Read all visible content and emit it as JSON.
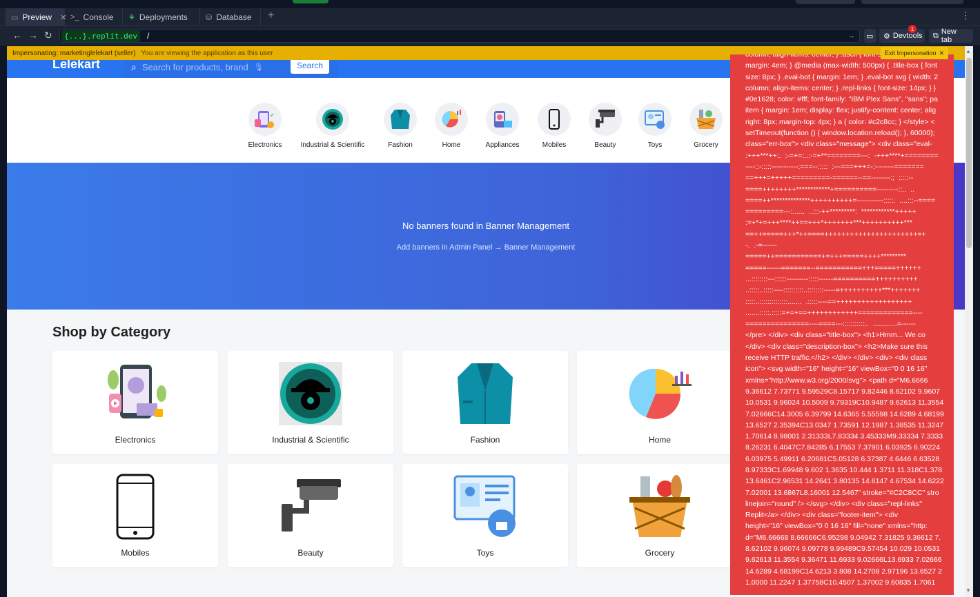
{
  "tabs": [
    {
      "label": "Preview",
      "icon": "monitor-icon",
      "active": true
    },
    {
      "label": "Console",
      "icon": "terminal-icon"
    },
    {
      "label": "Deployments",
      "icon": "deploy-icon"
    },
    {
      "label": "Database",
      "icon": "database-icon"
    }
  ],
  "address": {
    "domain": "{...}.replit.dev",
    "path": "/",
    "devtools_label": "Devtools",
    "devtools_badge": "1",
    "newtab_label": "New tab"
  },
  "impersonation": {
    "user": "Impersonating: marketinglelekart (seller)",
    "message": "You are viewing the application as this user",
    "exit_label": "Exit Impersonation"
  },
  "site": {
    "logo": "Lelekart",
    "search_placeholder": "Search for products, brand",
    "search_button": "Search"
  },
  "category_strip": [
    "Electronics",
    "Industrial & Scientific",
    "Fashion",
    "Home",
    "Appliances",
    "Mobiles",
    "Beauty",
    "Toys",
    "Grocery"
  ],
  "banner": {
    "title": "No banners found in Banner Management",
    "subtitle": "Add banners in Admin Panel → Banner Management"
  },
  "shop_by_category": {
    "title": "Shop by Category",
    "cards": [
      "Electronics",
      "Industrial & Scientific",
      "Fashion",
      "Home",
      "Mobiles",
      "Beauty",
      "Toys",
      "Grocery"
    ]
  },
  "error_overlay_text": "column; align-items: center; } .ascii { font-size: 6px; text-align\nmargin: 4em; } @media (max-width: 500px) { .title-box { font\nsize: 8px; } .eval-bot { margin: 1em; } .eval-bot svg { width: 2\ncolumn; align-items: center; } .repl-links { font-size: 14px; } }\n#0e1628; color: #fff; font-family: \"IBM Plex Sans\", \"sans\"; pa\nitem { margin: 1em; display: flex; justify-content: center; alig\nright: 8px; margin-top: 4px; } a { color: #c2c8cc; } </style> <\nsetTimeout(function () { window.location.reload(); }, 60000);\nclass=\"err-box\"> <div class=\"message\"> <div class=\"eval-\n:+++***++:.  :-=+=:..:-=+**========---:  -+++****+========\n----::-:::::-----------:===--:::::  :---===+++=-:--------=======\n==+++=+++++=========-======--==--------:;  :::::--\n====++++++++************+==========---------::..  ..\n====++**************++++++++++=-----------:::::.  ....:::--====\n=========---:......  ..:::-++*********:  ************+++++\n:=+*+=+++****++==+++*+++++++***++++++++++***\n==++=====+++*++====++++++++++++++++++++++=+\n-.  .-=------\n=====++===========+=+++=====++++*********\n=====------=======--===========+++=====++++++\n...::::::::---::::::---------:::::------==========++++++++++\n..:::::..:::::----::::::::::..::::::::-----=++++++++++***+++++++\n:::::..::::::::::::::.......  .:::::----==++++++++++++++++++\n.......:::::.:::::=+=+==++++++++++++=============----\n===============----====---:::::::::::..  ............=------\n</pre> </div> <div class=\"title-box\"> <h1>Hmm... We co\n</div> <div class=\"description-box\"> <h2>Make sure this\nreceive HTTP traffic.</h2> </div> </div> <div> <div class\nicon\"> <svg width=\"16\" height=\"16\" viewBox=\"0 0 16 16\"\nxmlns=\"http://www.w3.org/2000/svg\"> <path d=\"M6.6666\n9.36612 7.73771 9.59529C8.15717 9.82446 8.62102 9.9607\n10.0531 9.96024 10.5009 9.79319C10.9487 9.62613 11.3554\n7.02666C14.3005 6.39799 14.6365 5.55598 14.6289 4.68199\n13.6527 2.35394C13.0347 1.73591 12.1987 1.38535 11.3247\n1.70614 8.98001 2.31333L7.83334 3.45333M9.33334 7.3333\n8.26231 6.4047C7.84285 6.17553 7.37901 6.03925 6.90224\n6.03975 5.49911 6.20681C5.05128 6.37387 4.6446 6.63528\n8.97333C1.69948 9.602 1.3635 10.444 1.3711 11.318C1.378\n13.6461C2.96531 14.2641 3.80135 14.6147 4.67534 14.6222\n7.02001 13.6867L8.16001 12.5467\" stroke=\"#C2C8CC\" stro\nlinejoin=\"round\" /> </svg> </div> <div class=\"repl-links\"\nReplit</a> </div> <div class=\"footer-item\"> <div\nheight=\"16\" viewBox=\"0 0 16 16\" fill=\"none\" xmlns=\"http:\nd=\"M6.66668 8.66666C6.95298 9.04942 7.31825 9.36612 7.\n8.62102 9.96074 9.09778 9.99489C9.57454 10.029 10.0531\n9.62613 11.3554 9.36471 11.6933 9.02666L13.6933 7.02666\n14.6289 4.68199C14.6213 3.808 14.2708 2.97196 13.6527 2\n1.0000 11.2247 1.37758C10.4507 1.37002 9.60835 1.7061",
  "colors": {
    "header_blue": "#2874f0",
    "impersonation_yellow": "#e6b003",
    "error_red": "#e53e3e"
  }
}
